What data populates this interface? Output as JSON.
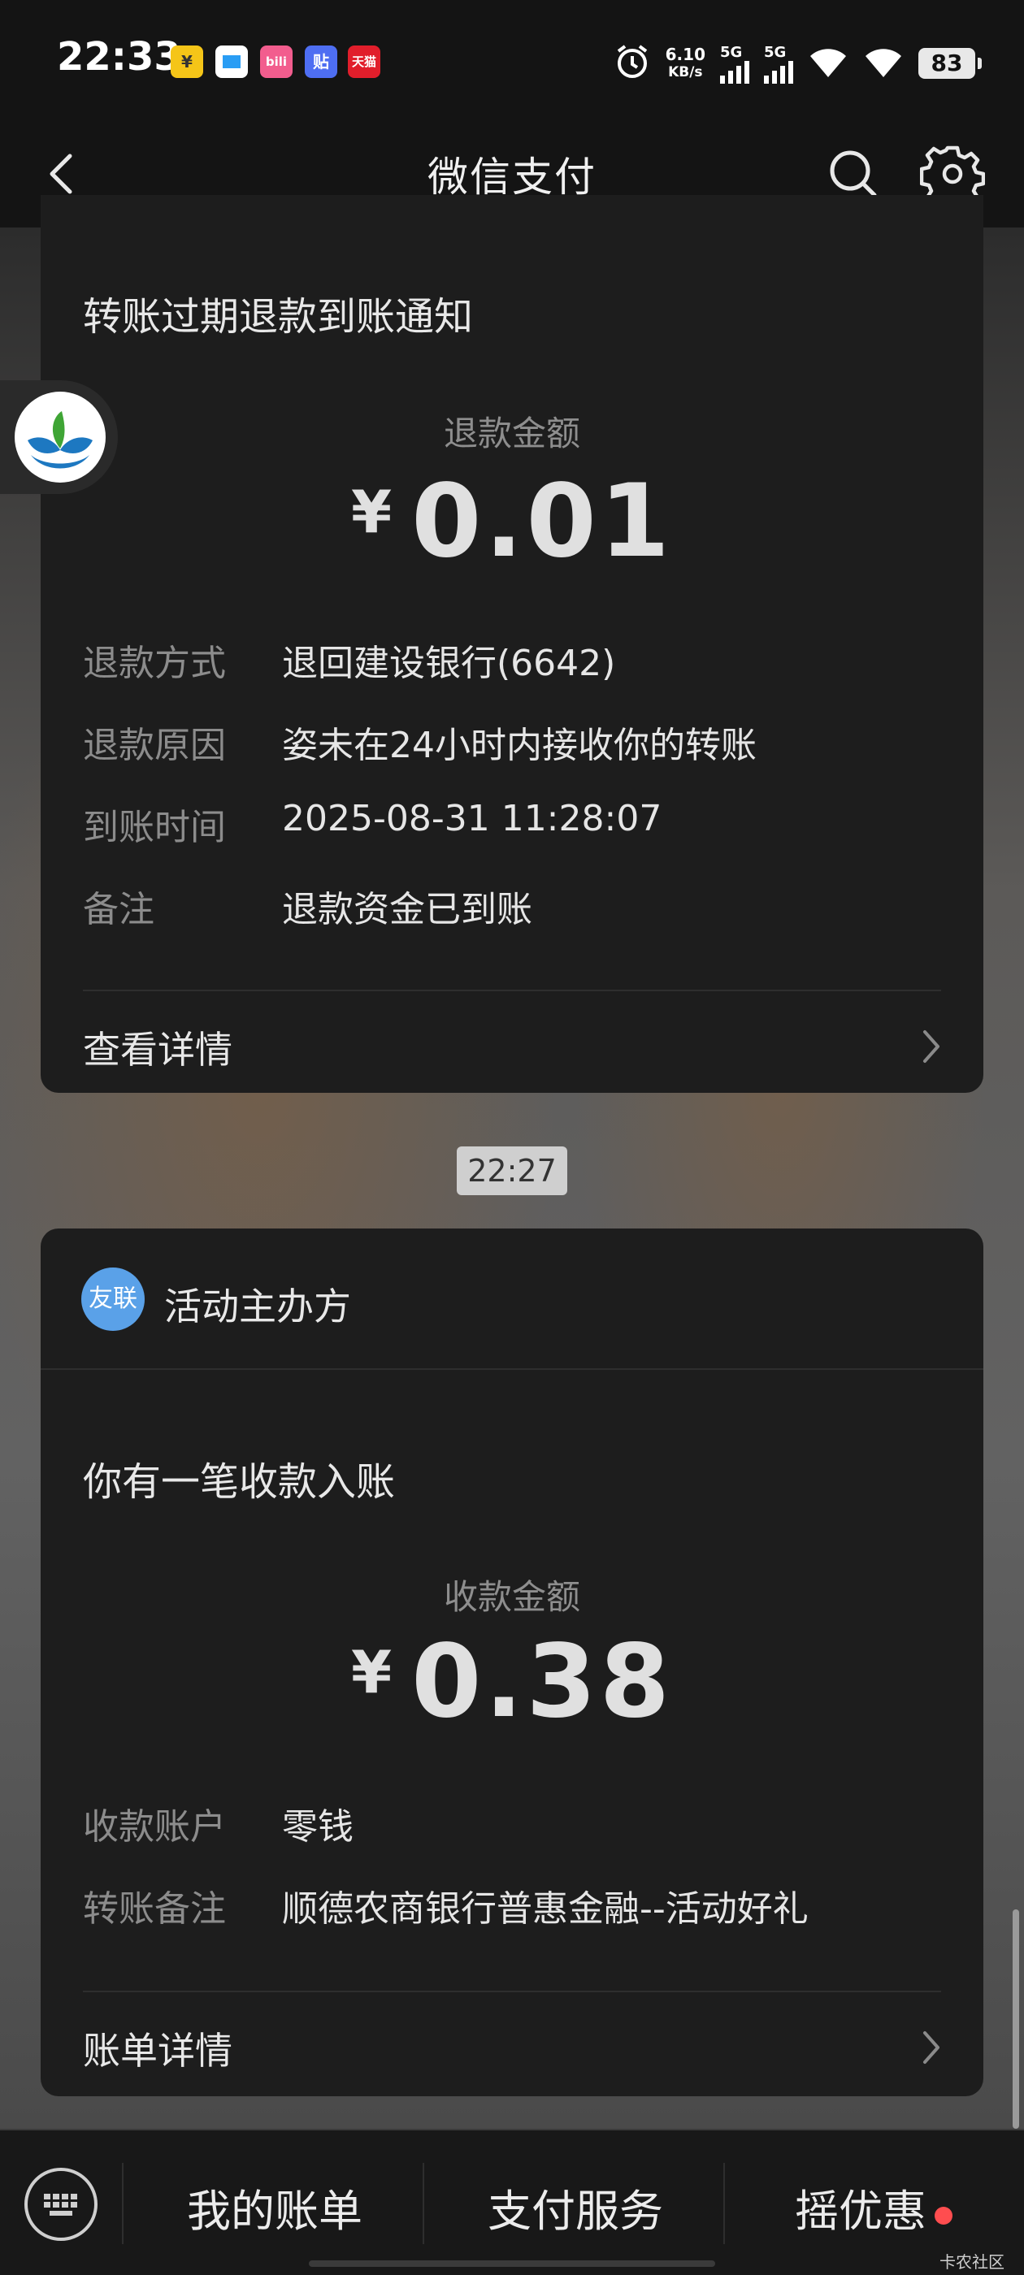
{
  "status_bar": {
    "time": "22:33",
    "app_icons": [
      {
        "name": "yuan-app-icon",
        "text": "¥",
        "color": "#f5c518"
      },
      {
        "name": "blue-square-app-icon",
        "text": "",
        "color": "#2a9df4"
      },
      {
        "name": "bilibili-app-icon",
        "text": "bili",
        "color": "#f25d8e"
      },
      {
        "name": "tie-app-icon",
        "text": "贴",
        "color": "#4e6ef2"
      },
      {
        "name": "tmall-app-icon",
        "text": "天猫",
        "color": "#e11e2b"
      }
    ],
    "net_speed_value": "6.10",
    "net_speed_unit": "KB/s",
    "sim1_label": "5G",
    "sim2_label": "5G",
    "battery": "83"
  },
  "nav": {
    "title": "微信支付"
  },
  "card_refund": {
    "title": "转账过期退款到账通知",
    "amount_label": "退款金额",
    "currency": "¥",
    "amount": "0.01",
    "rows": [
      {
        "key": "退款方式",
        "value": "退回建设银行(6642)"
      },
      {
        "key": "退款原因",
        "value": "姿未在24小时内接收你的转账"
      },
      {
        "key": "到账时间",
        "value": "2025-08-31 11:28:07"
      },
      {
        "key": "备注",
        "value": "退款资金已到账"
      }
    ],
    "link_label": "查看详情"
  },
  "timestamp": "22:27",
  "card_income": {
    "org_avatar_text": "友联",
    "org_name": "活动主办方",
    "title": "你有一笔收款入账",
    "amount_label": "收款金额",
    "currency": "¥",
    "amount": "0.38",
    "rows": [
      {
        "key": "收款账户",
        "value": "零钱"
      },
      {
        "key": "转账备注",
        "value": "顺德农商银行普惠金融--活动好礼"
      }
    ],
    "link_label": "账单详情"
  },
  "bottom_bar": {
    "tabs": [
      "我的账单",
      "支付服务",
      "摇优惠"
    ]
  },
  "watermark": "卡农社区"
}
